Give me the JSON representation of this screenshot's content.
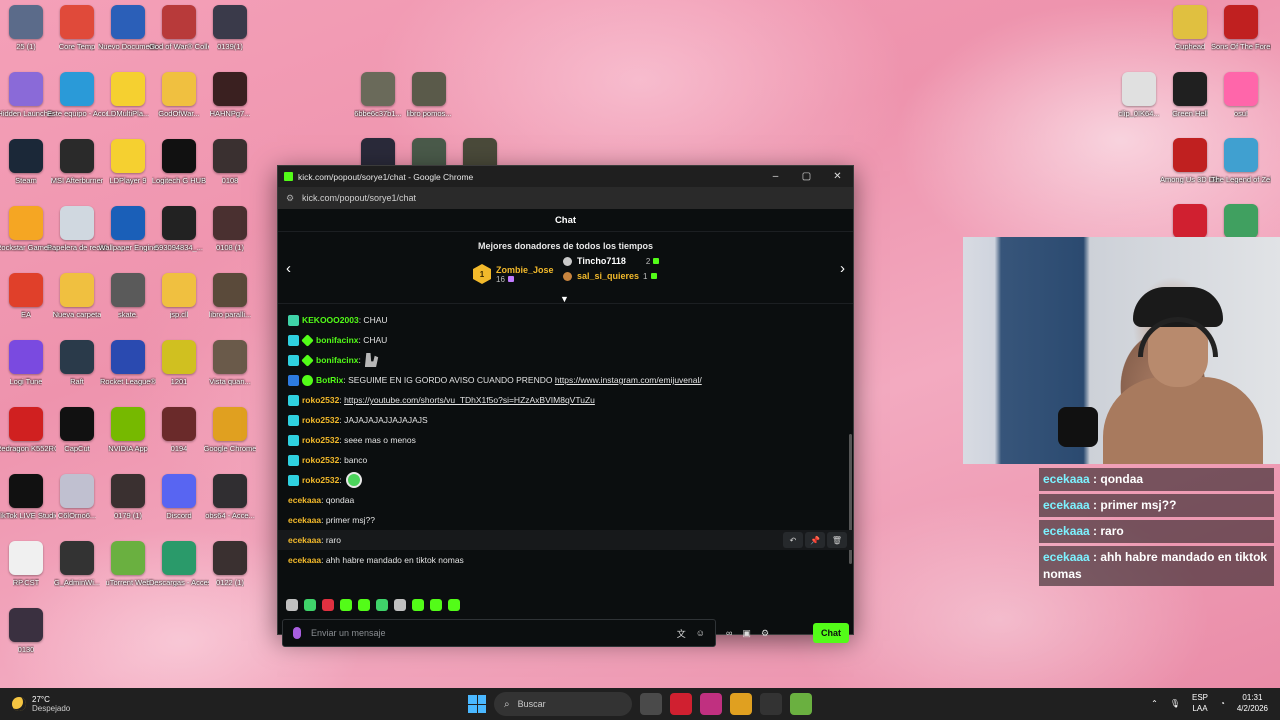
{
  "desktop": {
    "icons_left": [
      {
        "label": "25 (1)",
        "color": "#5b6b8a"
      },
      {
        "label": "Core Temp",
        "color": "#e04a3a"
      },
      {
        "label": "Nuevo Document...",
        "color": "#2b5fb8"
      },
      {
        "label": "God of War® Collection",
        "color": "#b83a3a"
      },
      {
        "label": "0139(1)",
        "color": "#3a3a4a"
      },
      {
        "label": "Hidden Launcher",
        "color": "#8a6ad8"
      },
      {
        "label": "Este equipo - Acceso dir...",
        "color": "#2a9ad8"
      },
      {
        "label": "LDMultiPla...",
        "color": "#f5d030"
      },
      {
        "label": "GodOfWar...",
        "color": "#f0c040"
      },
      {
        "label": "HAHNPg7...",
        "color": "#3a2020"
      },
      {
        "label": "Steam",
        "color": "#1b2838"
      },
      {
        "label": "MSI Afterburner",
        "color": "#2a2a2a"
      },
      {
        "label": "LDPlayer 9",
        "color": "#f5d030"
      },
      {
        "label": "Logitech G HUB",
        "color": "#111111"
      },
      {
        "label": "0108",
        "color": "#3a3030"
      },
      {
        "label": "Rockstar Games ...",
        "color": "#f5a623"
      },
      {
        "label": "Papelera de reciclaje",
        "color": "#d0d8e0"
      },
      {
        "label": "Wallpaper Engine",
        "color": "#1a5fb8"
      },
      {
        "label": "593094834_...",
        "color": "#222222"
      },
      {
        "label": "0108 (1)",
        "color": "#4a3030"
      },
      {
        "label": "EA",
        "color": "#e0402a"
      },
      {
        "label": "Nueva carpeta",
        "color": "#f0c040"
      },
      {
        "label": "skate.",
        "color": "#5a5a5a"
      },
      {
        "label": "jsp.cll",
        "color": "#f0c040"
      },
      {
        "label": "libro paralli...",
        "color": "#5a4a3a"
      },
      {
        "label": "Logi Tune",
        "color": "#7a4ae0"
      },
      {
        "label": "Raft",
        "color": "#2a3a4a"
      },
      {
        "label": "Rocket League®",
        "color": "#2a4ab0"
      },
      {
        "label": "1201",
        "color": "#d0c020"
      },
      {
        "label": "Vista quan...",
        "color": "#6a5a4a"
      },
      {
        "label": "Redragon K552RGB...",
        "color": "#d02020"
      },
      {
        "label": "CapCut",
        "color": "#111111"
      },
      {
        "label": "NVIDIA App",
        "color": "#76b900"
      },
      {
        "label": "0194",
        "color": "#6a2a2a"
      },
      {
        "label": "Google Chrome",
        "color": "#e0a020"
      },
      {
        "label": "TikTok LIVE Studio",
        "color": "#111111"
      },
      {
        "label": "C6lOrno6...",
        "color": "#c0c0d0"
      },
      {
        "label": "0179 (1)",
        "color": "#3a3030"
      },
      {
        "label": "Discord",
        "color": "#5865f2"
      },
      {
        "label": "obs64 - Acce...",
        "color": "#302e31"
      },
      {
        "label": "RP.CST",
        "color": "#f0f0f0"
      },
      {
        "label": "G_AdminWi...",
        "color": "#333333"
      },
      {
        "label": "uTorrent Web",
        "color": "#6ab040"
      },
      {
        "label": "Descargas - Acceso dir...",
        "color": "#2a9a6a"
      },
      {
        "label": "0122 (1)",
        "color": "#3a3030"
      },
      {
        "label": "0130",
        "color": "#3a3040"
      }
    ],
    "icons_mid": [
      {
        "label": "6bbe6c37b1...",
        "color": "#6a6a5a"
      },
      {
        "label": "libro pomos...",
        "color": "#5a5a4a"
      },
      {
        "label": "WHO",
        "color": "#2a2a3a"
      },
      {
        "label": "",
        "color": "#4a5a4a"
      },
      {
        "label": "",
        "color": "#4a4a3a"
      }
    ],
    "icons_right": [
      {
        "label": "Cuphead",
        "color": "#e0c040"
      },
      {
        "label": "Sons Of The Forest",
        "color": "#c02020"
      },
      {
        "label": "clip_0IK64...",
        "color": "#e0e0e0"
      },
      {
        "label": "Green Hell",
        "color": "#202020"
      },
      {
        "label": "osu!",
        "color": "#ff66aa"
      },
      {
        "label": "Among Us 3D Demo",
        "color": "#c02020"
      },
      {
        "label": "The Legend of Zelda Bri...",
        "color": "#40a0d0"
      },
      {
        "label": "",
        "color": "#d02030"
      },
      {
        "label": "",
        "color": "#40a060"
      }
    ]
  },
  "window": {
    "title": "kick.com/popout/sorye1/chat - Google Chrome",
    "url": "kick.com/popout/sorye1/chat",
    "controls": {
      "minimize": "–",
      "maximize": "▢",
      "close": "✕"
    }
  },
  "chat": {
    "header": "Chat",
    "donors": {
      "title": "Mejores donadores de todos los tiempos",
      "first": {
        "rank": "1",
        "name": "Zombie_Jose",
        "amount": "16"
      },
      "second": {
        "name": "Tincho7118",
        "amount": "2"
      },
      "third": {
        "name": "sal_si_quieres",
        "amount": "1"
      }
    },
    "messages": [
      {
        "user": "KEKOOO2003",
        "text": ": CHAU",
        "color": "#53fc18",
        "badges": [
          "sub"
        ]
      },
      {
        "user": "bonifacinx",
        "text": ": CHAU",
        "color": "#53fc18",
        "badges": [
          "vip",
          "diamond"
        ]
      },
      {
        "user": "bonifacinx",
        "text": ":",
        "color": "#53fc18",
        "badges": [
          "vip",
          "diamond"
        ],
        "emote": "emote2"
      },
      {
        "user": "BotRix",
        "text": ": SEGUIME EN IG GORDO AVISO CUANDO PRENDO ",
        "link": "https://www.instagram.com/emijuvenal/",
        "color": "#53fc18",
        "badges": [
          "bot",
          "verified"
        ]
      },
      {
        "user": "roko2532",
        "text": ": ",
        "link": "https://youtube.com/shorts/vu_TDhX1f5o?si=HZzAxBVIM8qVTuZu",
        "color": "#f2b92b",
        "badges": [
          "vip"
        ]
      },
      {
        "user": "roko2532",
        "text": ": JAJAJAJAJJAJAJAJS",
        "color": "#f2b92b",
        "badges": [
          "vip"
        ]
      },
      {
        "user": "roko2532",
        "text": ": seee mas o menos",
        "color": "#f2b92b",
        "badges": [
          "vip"
        ]
      },
      {
        "user": "roko2532",
        "text": ": banco",
        "color": "#f2b92b",
        "badges": [
          "vip"
        ]
      },
      {
        "user": "roko2532",
        "text": ":",
        "color": "#f2b92b",
        "badges": [
          "vip"
        ],
        "emote": "emote"
      },
      {
        "user": "ecekaaa",
        "text": ": qondaa",
        "color": "#f2b92b",
        "badges": []
      },
      {
        "user": "ecekaaa",
        "text": ": primer msj??",
        "color": "#f2b92b",
        "badges": []
      },
      {
        "user": "ecekaaa",
        "text": ": raro",
        "color": "#f2b92b",
        "badges": [],
        "hover": true
      },
      {
        "user": "ecekaaa",
        "text": ": ahh habre mandado en tiktok nomas",
        "color": "#f2b92b",
        "badges": []
      }
    ],
    "mod_tools": [
      "↶",
      "📌",
      "🗑"
    ],
    "input_placeholder": "Enviar un mensaje",
    "chat_button": "Chat",
    "emote_colors": [
      "#c0c0c0",
      "#3fd36a",
      "#e03040",
      "#53fc18",
      "#53fc18",
      "#3fd36a",
      "#c0c0c0",
      "#53fc18",
      "#53fc18",
      "#53fc18"
    ]
  },
  "overlay": {
    "messages": [
      {
        "user": "ecekaaa",
        "text": " : qondaa"
      },
      {
        "user": "ecekaaa",
        "text": " : primer msj??"
      },
      {
        "user": "ecekaaa",
        "text": " : raro"
      },
      {
        "user": "ecekaaa",
        "text": " : ahh habre mandado en tiktok nomas"
      }
    ]
  },
  "taskbar": {
    "weather_temp": "27°C",
    "weather_desc": "Despejado",
    "search_placeholder": "Buscar",
    "apps": [
      "#4a4a4a",
      "#d02030",
      "#c03080",
      "#e0a020",
      "#333333",
      "#6ab040"
    ],
    "lang_line1": "ESP",
    "lang_line2": "LAA",
    "time": "01:31",
    "date": "4/2/2026"
  }
}
